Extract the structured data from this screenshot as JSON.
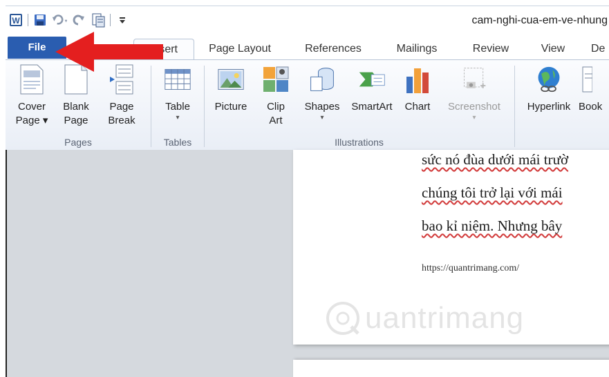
{
  "window": {
    "title": "cam-nghi-cua-em-ve-nhung"
  },
  "quick_access": {
    "icons": [
      "word-app-icon",
      "save-icon",
      "undo-icon",
      "redo-icon",
      "clipboard-icon",
      "customize-toolbar-icon"
    ]
  },
  "tabs": {
    "file": "File",
    "insert": "Insert",
    "page_layout": "Page Layout",
    "references": "References",
    "mailings": "Mailings",
    "review": "Review",
    "view": "View",
    "developer": "De"
  },
  "ribbon": {
    "groups": {
      "pages": "Pages",
      "tables": "Tables",
      "illustrations": "Illustrations"
    },
    "buttons": {
      "cover_page": {
        "line1": "Cover",
        "line2": "Page ▾"
      },
      "blank_page": {
        "line1": "Blank",
        "line2": "Page"
      },
      "page_break": {
        "line1": "Page",
        "line2": "Break"
      },
      "table": {
        "line1": "Table",
        "line2": "▾"
      },
      "picture": {
        "line1": "Picture"
      },
      "clip_art": {
        "line1": "Clip",
        "line2": "Art"
      },
      "shapes": {
        "line1": "Shapes",
        "line2": "▾"
      },
      "smartart": {
        "line1": "SmartArt"
      },
      "chart": {
        "line1": "Chart"
      },
      "screenshot": {
        "line1": "Screenshot",
        "line2": "▾"
      },
      "hyperlink": {
        "line1": "Hyperlink"
      },
      "bookmark": {
        "line1": "Book"
      }
    }
  },
  "document": {
    "lines": [
      "sức nó đùa dưới mái trườ",
      "chúng tôi trở lại với mái",
      "bao kỉ niệm. Nhưng bây"
    ],
    "url": "https://quantrimang.com/",
    "watermark": "uantrimang"
  },
  "colors": {
    "file_tab": "#2a5db0",
    "arrow": "#e41f1f",
    "doc_background": "#d5d9de"
  }
}
